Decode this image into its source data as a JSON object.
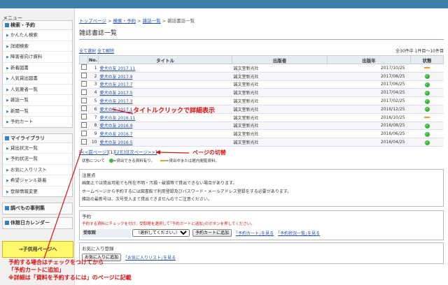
{
  "sidebar": {
    "menu_title": "メニュー",
    "sections": [
      {
        "title": "検索・予約",
        "items": [
          "かんたん検索",
          "詳細検索",
          "障害者向け資料",
          "新着図書",
          "人気貸出図書",
          "人気著者一覧",
          "雑誌一覧",
          "新聞一覧",
          "予約カート"
        ]
      },
      {
        "title": "マイライブラリ",
        "items": [
          "貸出状況一覧",
          "予約状況一覧",
          "お気に入りリスト",
          "希望ジャンル新着",
          "登録情報変更"
        ]
      },
      {
        "title": "調べもの事例集",
        "items": []
      },
      {
        "title": "休館日カレンダー",
        "items": []
      }
    ],
    "kids_button": "→子供用ページへ"
  },
  "breadcrumb": [
    "トップページ",
    "検索・予約",
    "雑誌一覧",
    "雑誌書誌一覧"
  ],
  "page_title": "雑誌書誌一覧",
  "select_all": "全て選択",
  "deselect_all": "全て解除",
  "count_text": "全30件中 1件目～10件目",
  "table": {
    "headers": [
      "No.",
      "タイトル",
      "出版者",
      "出版年",
      "状態"
    ],
    "rows": [
      {
        "no": "1",
        "title": "愛犬の友 2017.11",
        "publisher": "誠文堂新光社",
        "year": "2017/10/25",
        "status": "unavailable"
      },
      {
        "no": "2",
        "title": "愛犬の友 2017.9",
        "publisher": "誠文堂新光社",
        "year": "2017/08/25",
        "status": "available"
      },
      {
        "no": "3",
        "title": "愛犬の友 2017.7",
        "publisher": "誠文堂新光社",
        "year": "2017/06/25",
        "status": "available"
      },
      {
        "no": "4",
        "title": "愛犬の友 2017.5",
        "publisher": "誠文堂新光社",
        "year": "2017/04/25",
        "status": "available"
      },
      {
        "no": "5",
        "title": "愛犬の友 2017.3",
        "publisher": "誠文堂新光社",
        "year": "2017/02/25",
        "status": "available"
      },
      {
        "no": "6",
        "title": "愛犬の友 2017.1",
        "publisher": "誠文堂新光社",
        "year": "2016/12/25",
        "status": "available"
      },
      {
        "no": "7",
        "title": "愛犬の友 2016.11",
        "publisher": "誠文堂新光社",
        "year": "2016/10/25",
        "status": "unavailable"
      },
      {
        "no": "8",
        "title": "愛犬の友 2016.9",
        "publisher": "誠文堂新光社",
        "year": "2016/08/25",
        "status": "available"
      },
      {
        "no": "9",
        "title": "愛犬の友 2016.7",
        "publisher": "誠文堂新光社",
        "year": "2016/06/25",
        "status": "available"
      },
      {
        "no": "10",
        "title": "愛犬の友 2016.5",
        "publisher": "誠文堂新光社",
        "year": "2016/04/25",
        "status": "available"
      }
    ]
  },
  "pager": {
    "prev": "[<<前ページ]",
    "current": "[1]",
    "p2": "[2]",
    "p3": "[3]",
    "next": "[次ページ>>]"
  },
  "legend": {
    "label": "状態について",
    "ok": "=貸出できる資料有り。",
    "no": "=貸出中または館内閲覧資料。"
  },
  "notice": {
    "title": "注意点",
    "lines": [
      "画面上では貸出可能でも所在不明・汚損・破損等で貸出できない場合があります。",
      "ホームページから予約するには図書館で利用登録及びパスワード・メールアドレス登録をする必要があります。",
      "雑誌の最新号は、次号受入まで貸出できませんのでご注意ください。"
    ]
  },
  "reserve": {
    "title": "予約",
    "instruction": "予約する資料にチェックを付け、受取館を選択して｢予約カートに追加｣のボタンを押してください。",
    "pickup_label": "受取館",
    "select_placeholder": "（選択してください。）",
    "add_button": "予約カートに追加",
    "cart_link": "｢予約カート｣を見る",
    "status_link": "｢予約状況一覧｣を見る"
  },
  "favorites": {
    "title": "お気に入り登録",
    "add_button": "お気に入りに追加",
    "list_link": "｢お気に入りリスト｣を見る"
  },
  "annotations": {
    "title_click": "タイトルクリックで詳細表示",
    "page_switch": "ページの切替",
    "reserve_note_1": "予約する場合はチェックをつけてから",
    "reserve_note_2": "「予約カートに追加」",
    "reserve_note_3": "※詳細は「資料を予約するには」のページに記載"
  },
  "colors": {
    "header_bar": "#3d7fa7",
    "link": "#1d4db3",
    "annotation": "#e01010",
    "status_ok": "#3bb73b",
    "status_no": "#f29c1b",
    "kids_button": "#fff86a"
  }
}
